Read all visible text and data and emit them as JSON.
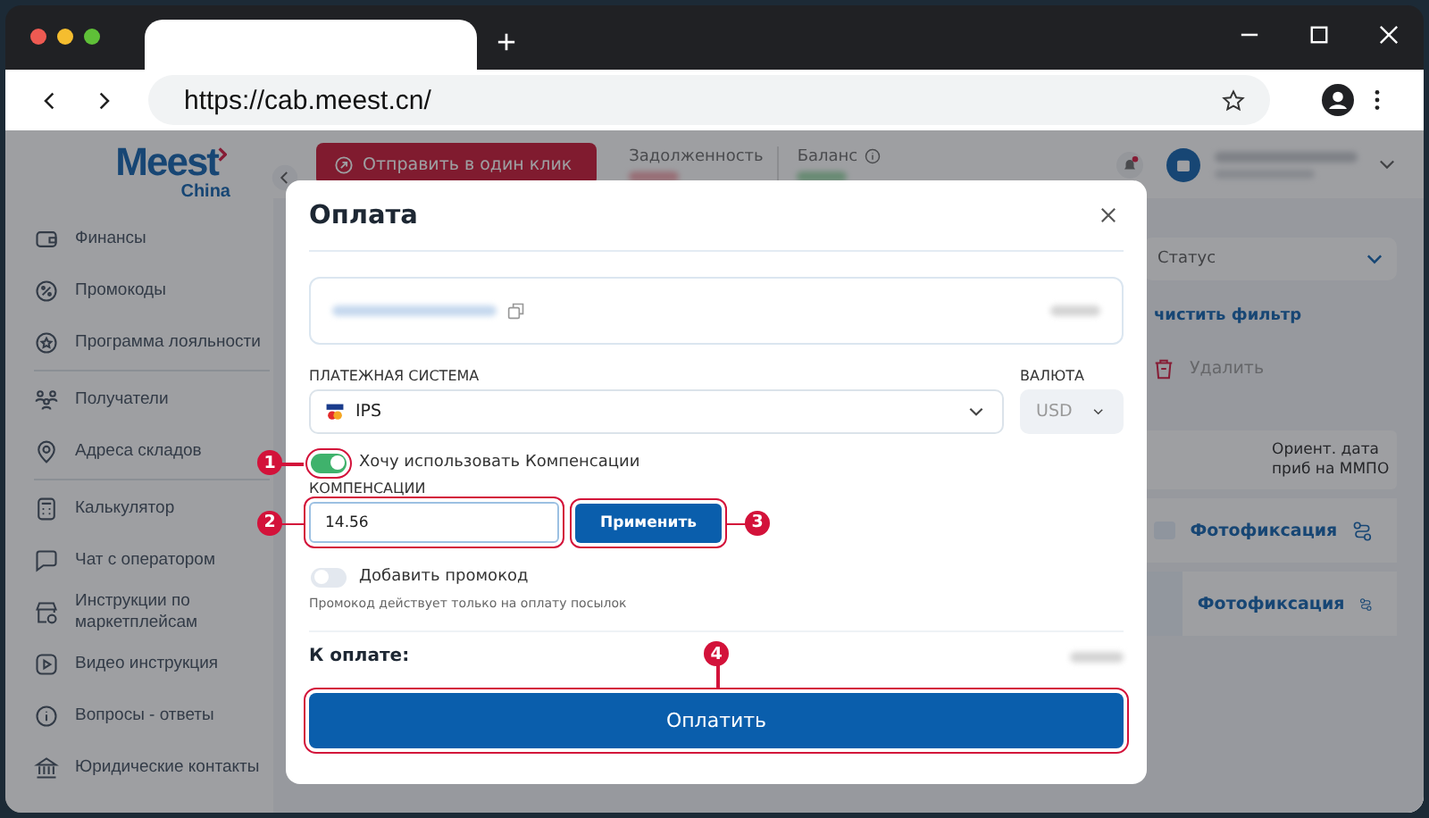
{
  "browser": {
    "url": "https://cab.meest.cn/"
  },
  "sidebar": {
    "logo": {
      "brand": "Meest",
      "sub": "China"
    },
    "groups": [
      [
        {
          "label": "Финансы",
          "kind": "wallet"
        },
        {
          "label": "Промокоды",
          "kind": "percent"
        },
        {
          "label": "Программа лояльности",
          "kind": "star"
        }
      ],
      [
        {
          "label": "Получатели",
          "kind": "people"
        },
        {
          "label": "Адреса складов",
          "kind": "pin"
        }
      ],
      [
        {
          "label": "Калькулятор",
          "kind": "calculator"
        },
        {
          "label": "Чат с оператором",
          "kind": "chat"
        },
        {
          "label": "Инструкции по маркетплейсам",
          "kind": "store"
        },
        {
          "label": "Видео инструкция",
          "kind": "play"
        },
        {
          "label": "Вопросы - ответы",
          "kind": "info"
        },
        {
          "label": "Юридические контакты",
          "kind": "bank"
        }
      ]
    ]
  },
  "header": {
    "send_button": "Отправить в один клик",
    "debt_label": "Задолженность",
    "balance_label": "Баланс",
    "has_notification": true
  },
  "background": {
    "status_filter": "Статус",
    "clear_filter": "чистить фильтр",
    "delete": "Удалить",
    "table_header": "Ориент. дата приб на ММПО",
    "rows": [
      {
        "action": "Фотофиксация"
      },
      {
        "action": "Фотофиксация"
      }
    ]
  },
  "modal": {
    "title": "Оплата",
    "payment_label": "ПЛАТЕЖНАЯ СИСТЕМА",
    "payment_value": "IPS",
    "currency_label": "ВАЛЮТА",
    "currency_value": "USD",
    "currency_disabled": true,
    "compensation_toggle": {
      "label": "Хочу использовать Компенсации",
      "on": true,
      "callout": "1"
    },
    "compensation_label": "КОМПЕНСАЦИИ",
    "compensation_input": {
      "value": "14.56",
      "callout": "2"
    },
    "apply_button": {
      "label": "Применить",
      "callout": "3"
    },
    "promo_toggle": {
      "label": "Добавить промокод",
      "on": false
    },
    "promo_hint": "Промокод действует только на оплату посылок",
    "total_label": "К оплате:",
    "pay_button": {
      "label": "Оплатить",
      "callout": "4"
    }
  }
}
